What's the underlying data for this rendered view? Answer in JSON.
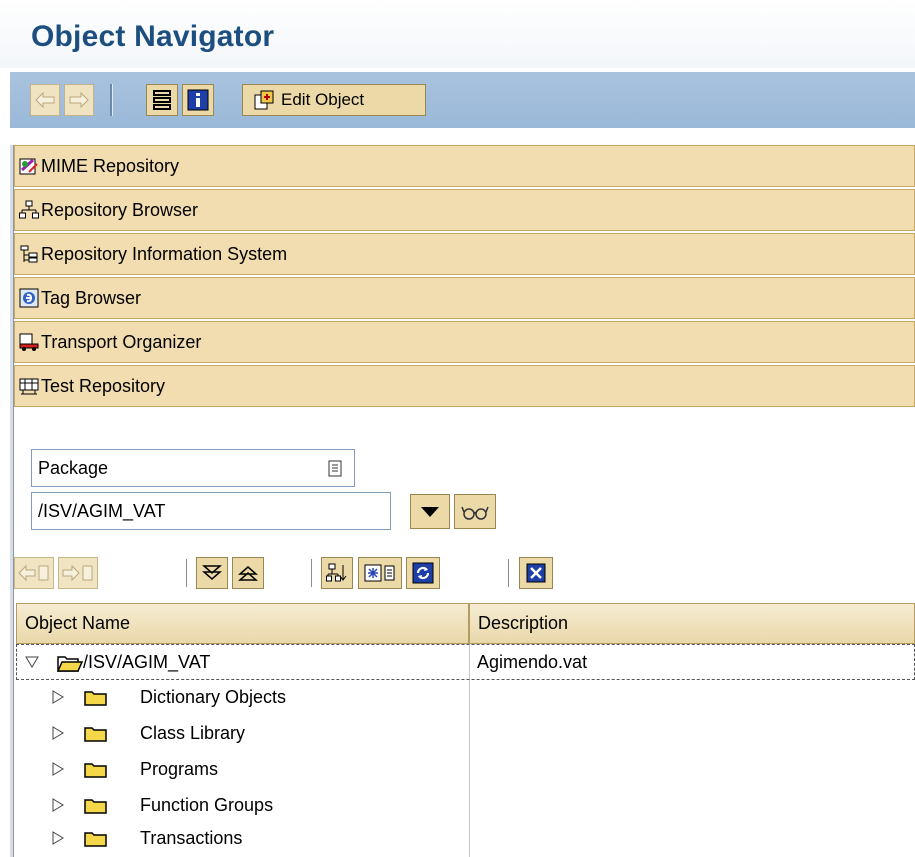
{
  "window": {
    "title": "Object Navigator"
  },
  "toolbar": {
    "edit_object_label": "Edit Object"
  },
  "panels": [
    {
      "label": "MIME Repository",
      "icon": "mime-repository-icon"
    },
    {
      "label": "Repository Browser",
      "icon": "repository-browser-icon"
    },
    {
      "label": "Repository Information System",
      "icon": "repository-info-system-icon"
    },
    {
      "label": "Tag Browser",
      "icon": "tag-browser-icon"
    },
    {
      "label": "Transport Organizer",
      "icon": "transport-organizer-icon"
    },
    {
      "label": "Test Repository",
      "icon": "test-repository-icon"
    }
  ],
  "selector": {
    "object_type": "Package",
    "object_value": "/ISV/AGIM_VAT"
  },
  "tree": {
    "columns": [
      "Object Name",
      "Description"
    ],
    "root": {
      "name": "/ISV/AGIM_VAT",
      "description": "Agimendo.vat"
    },
    "children": [
      {
        "name": "Dictionary Objects"
      },
      {
        "name": "Class Library"
      },
      {
        "name": "Programs"
      },
      {
        "name": "Function Groups"
      },
      {
        "name": "Transactions"
      }
    ]
  }
}
